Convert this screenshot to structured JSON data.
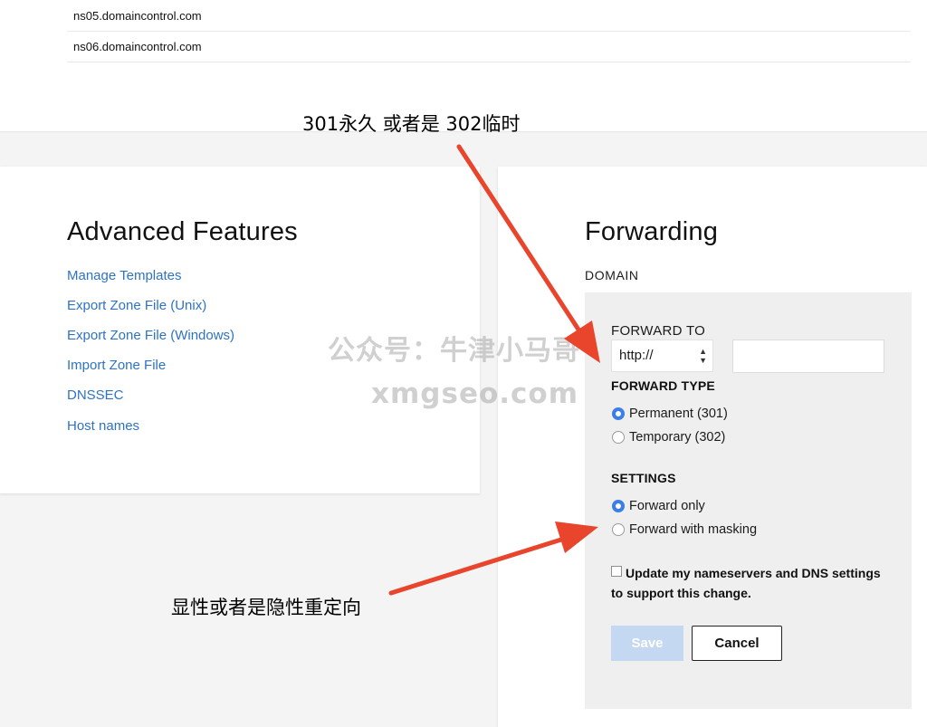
{
  "nameservers": [
    "ns05.domaincontrol.com",
    "ns06.domaincontrol.com"
  ],
  "advanced": {
    "title": "Advanced Features",
    "links": [
      "Manage Templates",
      "Export Zone File (Unix)",
      "Export Zone File (Windows)",
      "Import Zone File",
      "DNSSEC",
      "Host names"
    ]
  },
  "forwarding": {
    "title": "Forwarding",
    "domain_label": "DOMAIN",
    "forward_to_label": "FORWARD TO",
    "protocol_value": "http://",
    "url_value": "",
    "forward_type_label": "FORWARD TYPE",
    "forward_types": [
      {
        "label": "Permanent (301)",
        "checked": true
      },
      {
        "label": "Temporary (302)",
        "checked": false
      }
    ],
    "settings_label": "SETTINGS",
    "settings": [
      {
        "label": "Forward only",
        "checked": true
      },
      {
        "label": "Forward with masking",
        "checked": false
      }
    ],
    "update_checkbox_label": "Update my nameservers and DNS settings to support this change.",
    "update_checked": false,
    "save_label": "Save",
    "cancel_label": "Cancel"
  },
  "annotations": {
    "top": "301永久 或者是 302临时",
    "bottom": "显性或者是隐性重定向",
    "arrow_color": "#e8452c"
  },
  "watermark": {
    "line1": "公众号：牛津小马哥",
    "line2": "xmgseo.com"
  },
  "colors": {
    "link": "#2d73c4",
    "radio_checked": "#3a7ee6",
    "save_disabled": "#c4d8f2"
  }
}
